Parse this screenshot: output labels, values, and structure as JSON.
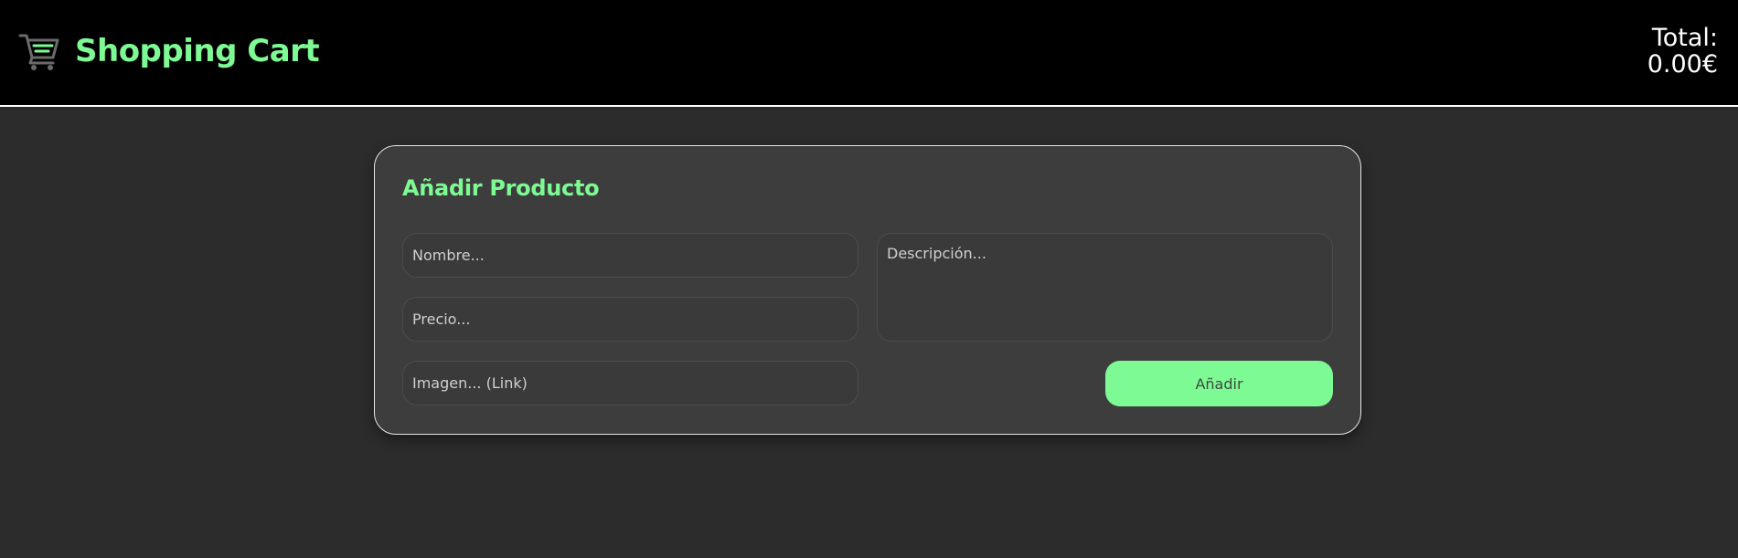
{
  "header": {
    "brand": "Shopping Cart",
    "cart_icon": "shopping-cart-icon",
    "total_label": "Total:",
    "total_value": "0.00€"
  },
  "form": {
    "title": "Añadir Producto",
    "name_placeholder": "Nombre...",
    "price_placeholder": "Precio...",
    "image_placeholder": "Imagen... (Link)",
    "description_placeholder": "Descripción...",
    "submit_label": "Añadir"
  },
  "colors": {
    "accent": "#7dfa93",
    "header_bg": "#000000",
    "page_bg": "#2c2c2c",
    "card_bg": "#3d3d3d"
  }
}
